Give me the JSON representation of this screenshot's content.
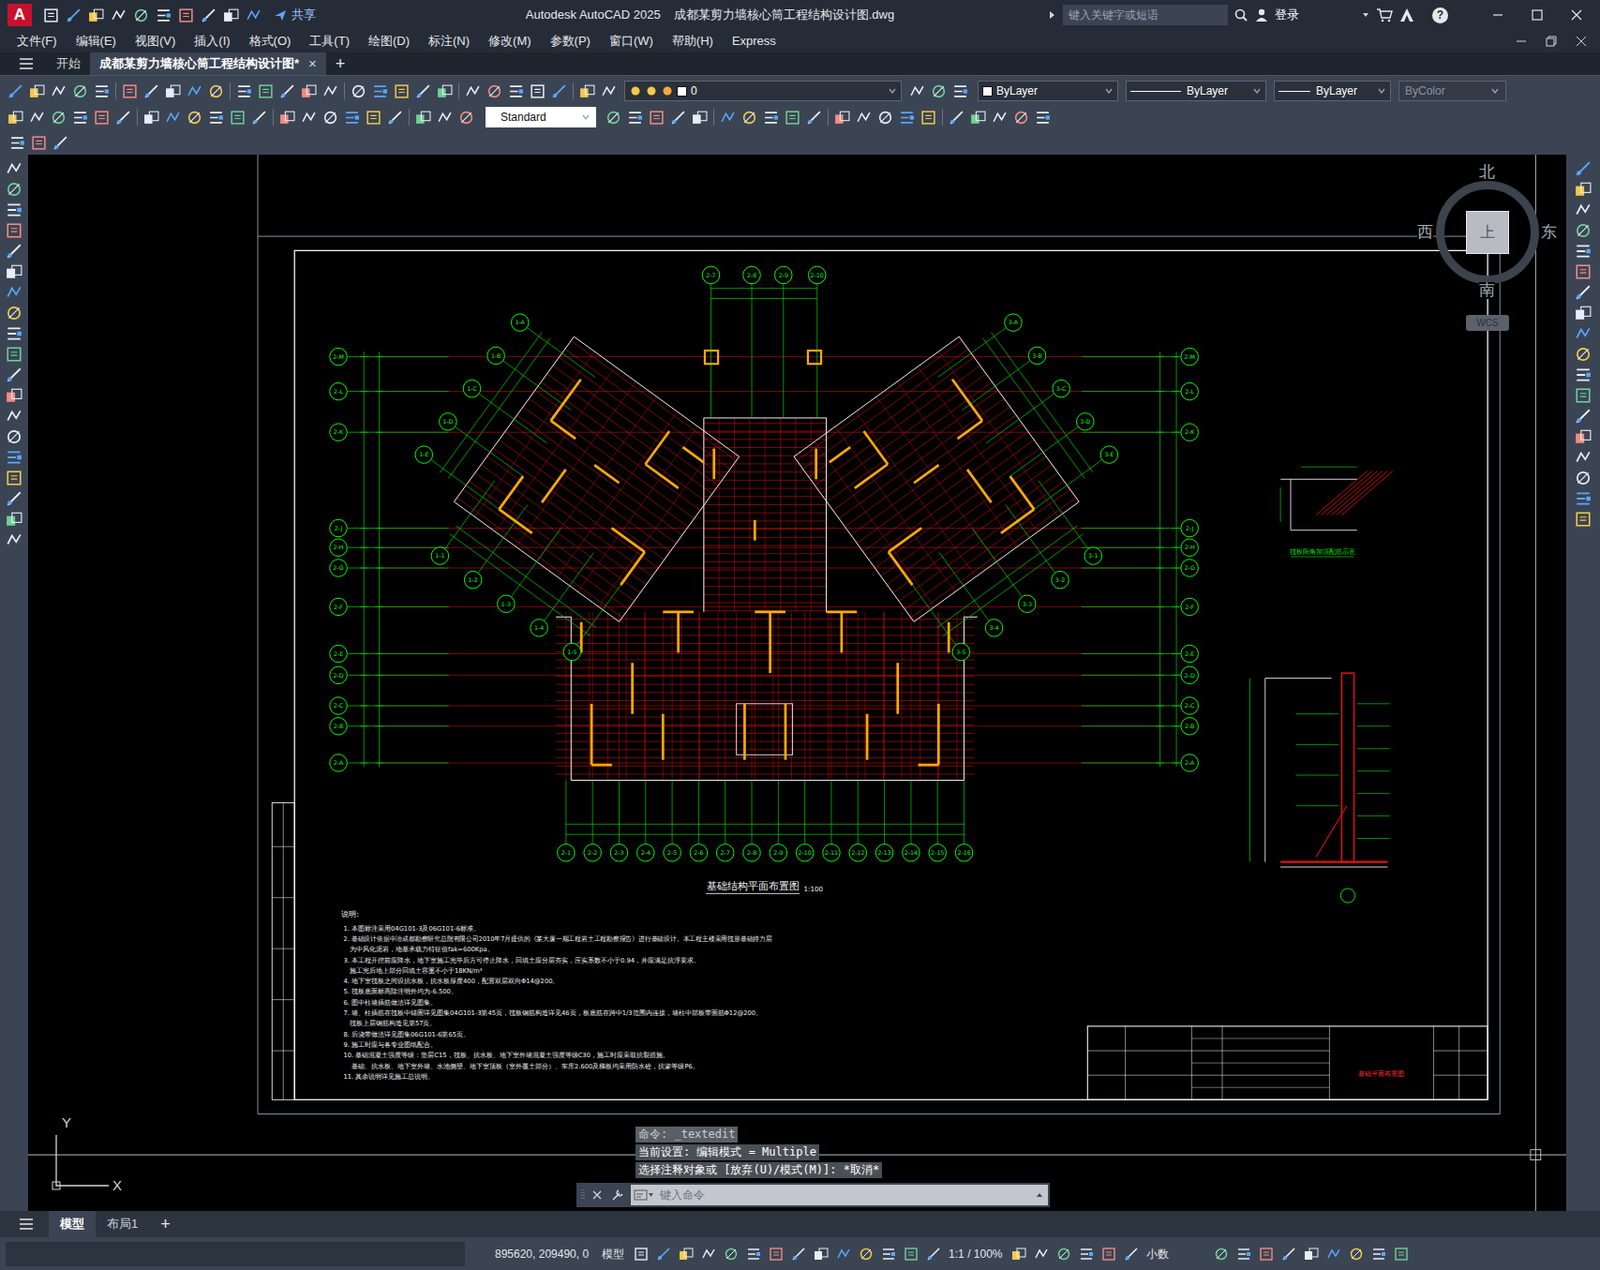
{
  "window": {
    "logo": "A",
    "share": "共享",
    "app": "Autodesk AutoCAD 2025",
    "file": "成都某剪力墙核心筒工程结构设计图.dwg",
    "search_placeholder": "键入关键字或短语",
    "login": "登录",
    "help": "?"
  },
  "menu": [
    "文件(F)",
    "编辑(E)",
    "视图(V)",
    "插入(I)",
    "格式(O)",
    "工具(T)",
    "绘图(D)",
    "标注(N)",
    "修改(M)",
    "参数(P)",
    "窗口(W)",
    "帮助(H)",
    "Express"
  ],
  "doc_tabs": [
    {
      "label": "开始",
      "selected": false
    },
    {
      "label": "成都某剪力墙核心筒工程结构设计图*",
      "selected": true
    }
  ],
  "doc_tab_close": "×",
  "new_tab": "+",
  "toolbar": {
    "layer": "0",
    "color": "ByLayer",
    "linetype": "ByLayer",
    "lineweight": "ByLayer",
    "plotstyle": {
      "label": "ByColor",
      "disabled": true
    },
    "textstyle": "Standard"
  },
  "viewcube": {
    "north": "北",
    "south": "南",
    "east": "东",
    "west": "西",
    "face": "上",
    "ucs": "WCS"
  },
  "ucs_icon": {
    "x": "X",
    "y": "Y"
  },
  "drawing": {
    "title": "基础结构平面布置图",
    "scale": "1:100",
    "detail_title": "筏板阳角加强配筋示意",
    "titleblock_name": "基础平面布置图",
    "notes_title": "说明:",
    "notes": [
      "1. 本图标注采用04G101-3及06G101-6标准。",
      "2. 基础设计依据中冶成都勘察研究总院有限公司2010年7月提供的《某大厦一期工程岩土工程勘察报告》进行基础设计。本工程主楼采用筏形基础持力层",
      "   为中风化泥岩，地基承载力特征值fak=600Kpa。",
      "3. 本工程开挖前应降水，地下室施工完毕后方可停止降水，回填土应分层夯实，压实系数不小于0.94，并应满足抗浮要求。",
      "   施工完后地上部分回填土容重不小于18KN/m³",
      "4. 地下室筏板之间设抗水板，抗水板厚度400，配置双层双向Φ14@200。",
      "5. 筏板底面标高除注明外均为-6.500。",
      "6. 图中柱墙插筋做法详见图集。",
      "7. 墙、柱插筋在筏板中锚固详见图集04G101-3第45页，筏板钢筋构造详见46页，板底筋在跨中1/3范围内连接，墙柱中部板带面筋Φ12@200。",
      "   筏板上层钢筋构造见第57页。",
      "8. 后浇带做法详见图集06G101-6第65页。",
      "9. 施工时应与各专业图纸配合。",
      "10. 基础混凝土强度等级：垫层C15，筏板、抗水板、地下室外墙混凝土强度等级C30，施工时应采取抗裂措施。",
      "    基础、抗水板、地下室外墙、水池侧壁、地下室顶板（室外覆土部分）、车库2.600及梯板均采用防水砼，抗渗等级P6。",
      "11. 其余说明详见施工总说明。"
    ],
    "axes": {
      "left": [
        "2-M",
        "2-L",
        "2-K",
        "2-J",
        "2-H",
        "2-G",
        "2-F",
        "2-E",
        "2-D",
        "2-C",
        "2-B",
        "2-A"
      ],
      "right": [
        "2-M",
        "2-L",
        "2-K",
        "2-J",
        "2-H",
        "2-G",
        "2-F",
        "2-E",
        "2-D",
        "2-C",
        "2-B",
        "2-A"
      ],
      "top": [
        "2-7",
        "2-8",
        "2-9",
        "2-10"
      ],
      "bottom": [
        "2-1",
        "2-2",
        "2-3",
        "2-4",
        "2-5",
        "2-6",
        "2-7",
        "2-8",
        "2-9",
        "2-10",
        "2-11",
        "2-12",
        "2-13",
        "2-14",
        "2-15",
        "2-16"
      ],
      "wing_left_a": [
        "1-A",
        "1-B",
        "1-C",
        "1-D",
        "1-E"
      ],
      "wing_left_b": [
        "1-1",
        "1-2",
        "1-3",
        "1-4",
        "1-5"
      ],
      "wing_right_a": [
        "3-A",
        "3-B",
        "3-C",
        "3-D",
        "3-E"
      ],
      "wing_right_b": [
        "3-1",
        "3-2",
        "3-3",
        "3-4",
        "3-5"
      ]
    }
  },
  "command": {
    "history": [
      "命令: _textedit",
      "当前设置: 编辑模式 = Multiple",
      "选择注释对象或 [放弃(U)/模式(M)]: *取消*"
    ],
    "placeholder": "键入命令"
  },
  "layout_tabs": [
    {
      "label": "模型",
      "selected": true
    },
    {
      "label": "布局1",
      "selected": false
    }
  ],
  "new_layout": "+",
  "status": {
    "coords": "895620, 209490, 0",
    "space": "模型",
    "scale": "1:1 / 100%",
    "units": "小数"
  }
}
